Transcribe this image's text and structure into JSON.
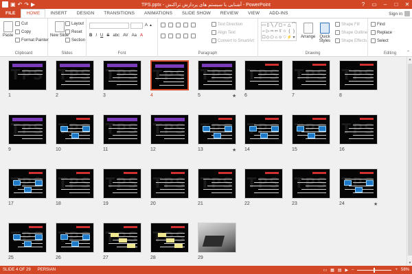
{
  "titlebar": {
    "app_icon": "P",
    "title": "TPS.pptx - آشنایی با سیستم های پردازش تراکنش - PowerPoint",
    "qat": [
      "save-icon",
      "undo-icon",
      "redo-icon",
      "start-from-beginning-icon"
    ],
    "controls": [
      "?",
      "▭",
      "–",
      "□",
      "✕"
    ]
  },
  "tabs": [
    "FILE",
    "HOME",
    "INSERT",
    "DESIGN",
    "TRANSITIONS",
    "ANIMATIONS",
    "SLIDE SHOW",
    "REVIEW",
    "VIEW",
    "ADD-INS"
  ],
  "active_tab": "HOME",
  "signin": "Sign in",
  "ribbon": {
    "clipboard": {
      "paste": "Paste",
      "cut": "Cut",
      "copy": "Copy",
      "format_painter": "Format Painter",
      "label": "Clipboard"
    },
    "slides": {
      "new_slide": "New Slide",
      "layout": "Layout",
      "reset": "Reset",
      "section": "Section",
      "label": "Slides"
    },
    "font": {
      "label": "Font",
      "buttons": [
        "B",
        "I",
        "U",
        "S",
        "abc",
        "AV",
        "Aa",
        "A"
      ]
    },
    "paragraph": {
      "text_direction": "Text Direction",
      "align_text": "Align Text",
      "convert_smartart": "Convert to SmartArt",
      "label": "Paragraph"
    },
    "drawing": {
      "arrange": "Arrange",
      "quick_styles": "Quick Styles",
      "shape_fill": "Shape Fill",
      "shape_outline": "Shape Outline",
      "shape_effects": "Shape Effects",
      "label": "Drawing"
    },
    "editing": {
      "find": "Find",
      "replace": "Replace",
      "select": "Select",
      "label": "Editing"
    }
  },
  "sorter": {
    "slides": [
      {
        "n": "1",
        "star": false
      },
      {
        "n": "2",
        "star": false
      },
      {
        "n": "3",
        "star": false
      },
      {
        "n": "4",
        "star": false
      },
      {
        "n": "5",
        "star": true
      },
      {
        "n": "6",
        "star": false
      },
      {
        "n": "7",
        "star": false
      },
      {
        "n": "8",
        "star": false
      },
      {
        "n": "9",
        "star": false
      },
      {
        "n": "10",
        "star": false
      },
      {
        "n": "11",
        "star": false
      },
      {
        "n": "12",
        "star": false
      },
      {
        "n": "13",
        "star": true
      },
      {
        "n": "14",
        "star": false
      },
      {
        "n": "15",
        "star": false
      },
      {
        "n": "16",
        "star": false
      },
      {
        "n": "17",
        "star": false
      },
      {
        "n": "18",
        "star": false
      },
      {
        "n": "19",
        "star": false
      },
      {
        "n": "20",
        "star": false
      },
      {
        "n": "21",
        "star": false
      },
      {
        "n": "22",
        "star": false
      },
      {
        "n": "23",
        "star": false
      },
      {
        "n": "24",
        "star": true
      },
      {
        "n": "25",
        "star": false
      },
      {
        "n": "26",
        "star": false
      },
      {
        "n": "27",
        "star": false
      },
      {
        "n": "28",
        "star": false
      },
      {
        "n": "29",
        "star": false
      }
    ],
    "selected": "4",
    "watermark": "TPS",
    "star_glyph": "★"
  },
  "status": {
    "slide_info": "SLIDE 4 OF 29",
    "language": "PERSIAN",
    "zoom": "58%"
  },
  "colors": {
    "accent": "#d24726",
    "slide_bg": "#050505",
    "title_bar_purple": "#7c3bb8"
  }
}
